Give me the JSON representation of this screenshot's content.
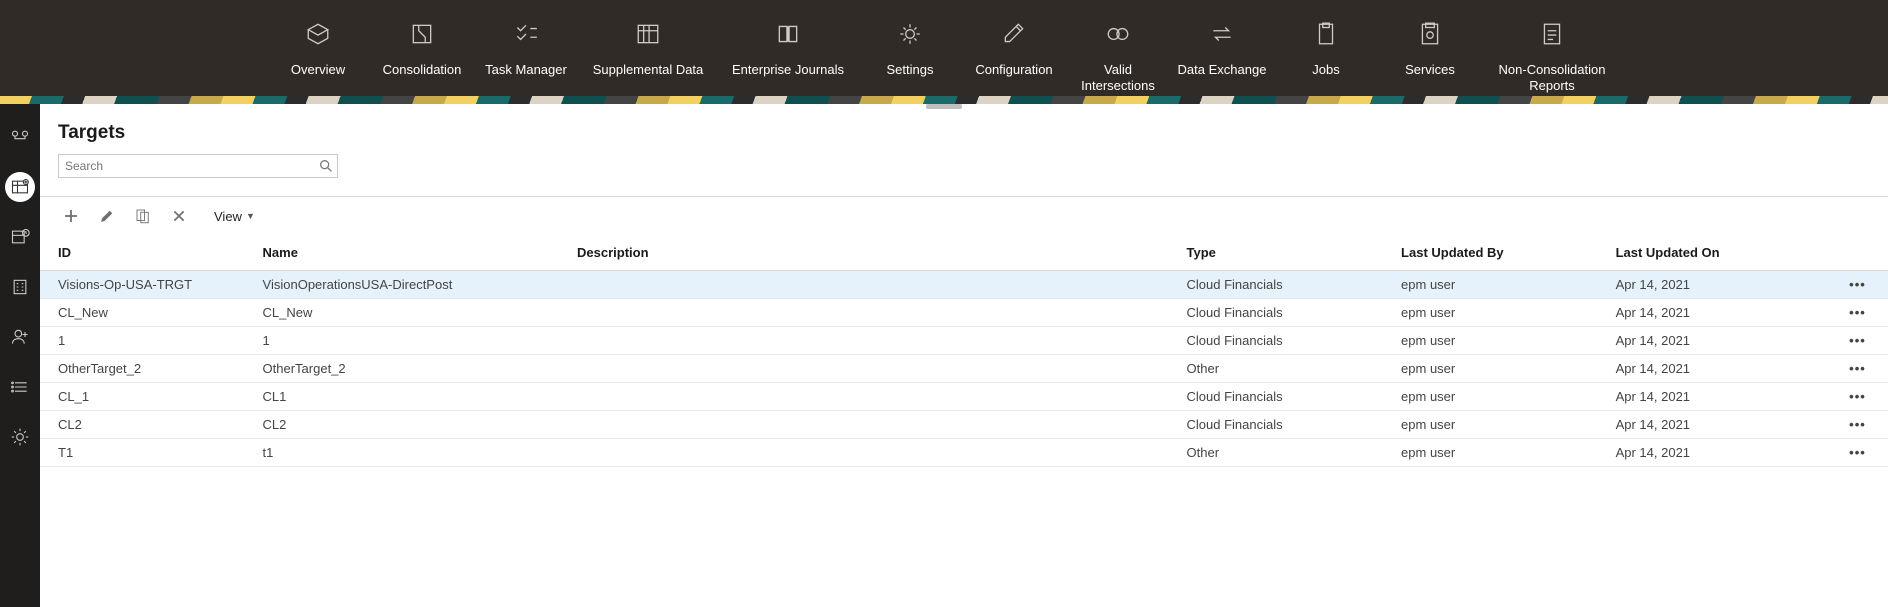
{
  "topnav": [
    {
      "label": "Overview"
    },
    {
      "label": "Consolidation"
    },
    {
      "label": "Task Manager"
    },
    {
      "label": "Supplemental Data",
      "wide": true
    },
    {
      "label": "Enterprise Journals",
      "wide": true,
      "merge_right": true
    },
    {
      "label": "Settings"
    },
    {
      "label": "Configuration"
    },
    {
      "label": "Valid Intersections"
    },
    {
      "label": "Data Exchange"
    },
    {
      "label": "Jobs"
    },
    {
      "label": "Services"
    },
    {
      "label": "Non-Consolidation Reports",
      "wide": true
    }
  ],
  "page": {
    "title": "Targets",
    "search_placeholder": "Search",
    "view_label": "View"
  },
  "columns": {
    "id": "ID",
    "name": "Name",
    "description": "Description",
    "type": "Type",
    "updated_by": "Last Updated By",
    "updated_on": "Last Updated On"
  },
  "rows": [
    {
      "id": "Visions-Op-USA-TRGT",
      "name": "VisionOperationsUSA-DirectPost",
      "description": "",
      "type": "Cloud Financials",
      "updated_by": "epm user",
      "updated_on": "Apr 14, 2021",
      "selected": true
    },
    {
      "id": "CL_New",
      "name": "CL_New",
      "description": "",
      "type": "Cloud Financials",
      "updated_by": "epm user",
      "updated_on": "Apr 14, 2021"
    },
    {
      "id": "1",
      "name": "1",
      "description": "",
      "type": "Cloud Financials",
      "updated_by": "epm user",
      "updated_on": "Apr 14, 2021"
    },
    {
      "id": "OtherTarget_2",
      "name": "OtherTarget_2",
      "description": "",
      "type": "Other",
      "updated_by": "epm user",
      "updated_on": "Apr 14, 2021"
    },
    {
      "id": "CL_1",
      "name": "CL1",
      "description": "",
      "type": "Cloud Financials",
      "updated_by": "epm user",
      "updated_on": "Apr 14, 2021"
    },
    {
      "id": "CL2",
      "name": "CL2",
      "description": "",
      "type": "Cloud Financials",
      "updated_by": "epm user",
      "updated_on": "Apr 14, 2021"
    },
    {
      "id": "T1",
      "name": "t1",
      "description": "",
      "type": "Other",
      "updated_by": "epm user",
      "updated_on": "Apr 14, 2021"
    }
  ]
}
